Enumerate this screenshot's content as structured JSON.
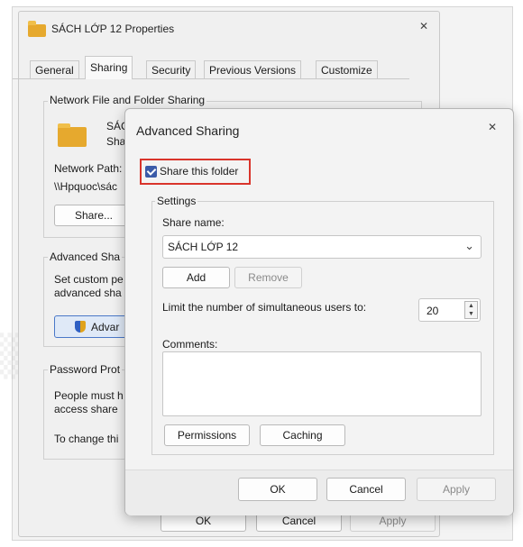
{
  "properties": {
    "title": "SÁCH LỚP 12 Properties",
    "tabs": [
      "General",
      "Sharing",
      "Security",
      "Previous Versions",
      "Customize"
    ],
    "network_group_title": "Network File and Folder Sharing",
    "folder_name_partial": "SÁC",
    "folder_state_partial": "Sha",
    "network_path_label": "Network Path:",
    "network_path_value": "\\\\Hpquoc\\sác",
    "share_button": "Share...",
    "advanced_group_title": "Advanced Sha",
    "advanced_desc_1": "Set custom pe",
    "advanced_desc_2": "advanced sha",
    "advanced_button": "Advar",
    "password_group_title": "Password Prot",
    "password_desc_1": "People must h",
    "password_desc_2": "access share",
    "password_desc_3": "To change thi",
    "ok": "OK",
    "cancel": "Cancel",
    "apply": "Apply"
  },
  "advanced": {
    "title": "Advanced Sharing",
    "share_checkbox_label": "Share this folder",
    "share_checked": true,
    "settings_title": "Settings",
    "share_name_label": "Share name:",
    "share_name_value": "SÁCH LỚP 12",
    "add": "Add",
    "remove": "Remove",
    "limit_label": "Limit the number of simultaneous users to:",
    "limit_value": "20",
    "comments_label": "Comments:",
    "permissions": "Permissions",
    "caching": "Caching",
    "ok": "OK",
    "cancel": "Cancel",
    "apply": "Apply"
  },
  "icons": {
    "close": "close-icon",
    "folder": "folder-icon",
    "shield": "shield-icon",
    "chevron": "chevron-down-icon",
    "spinner": "spinner-icon"
  },
  "colors": {
    "highlight": "#d9342b",
    "checkbox": "#3b5ba8",
    "folder": "#e6a92e"
  }
}
